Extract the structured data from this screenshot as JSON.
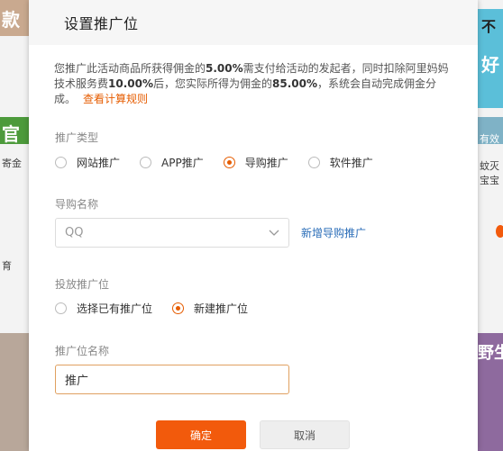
{
  "background": {
    "left_texts": [
      "款",
      "官",
      "寄金",
      "育"
    ],
    "right_texts": [
      "不",
      "好",
      "有效",
      "蚊灭",
      "宝宝",
      "野生"
    ]
  },
  "dialog": {
    "title": "设置推广位",
    "notice": {
      "text1": "您推广此活动商品所获得佣金的",
      "pct1": "5.00%",
      "text2": "需支付给活动的发起者，同时扣除阿里妈妈技术服务费",
      "pct2": "10.00%",
      "text3": "后，您实际所得为佣金的",
      "pct3": "85.00%",
      "text4": "，系统会自动完成佣金分成。",
      "link": "查看计算规则"
    },
    "promo_type": {
      "label": "推广类型",
      "options": [
        {
          "label": "网站推广",
          "selected": false
        },
        {
          "label": "APP推广",
          "selected": false
        },
        {
          "label": "导购推广",
          "selected": true
        },
        {
          "label": "软件推广",
          "selected": false
        }
      ]
    },
    "guide_name": {
      "label": "导购名称",
      "value": "QQ",
      "add_link": "新增导购推广"
    },
    "placement": {
      "label": "投放推广位",
      "options": [
        {
          "label": "选择已有推广位",
          "selected": false
        },
        {
          "label": "新建推广位",
          "selected": true
        }
      ]
    },
    "position_name": {
      "label": "推广位名称",
      "value": "推广"
    },
    "buttons": {
      "ok": "确定",
      "cancel": "取消"
    }
  },
  "colors": {
    "accent": "#f25a0c",
    "link": "#2a6db8"
  }
}
